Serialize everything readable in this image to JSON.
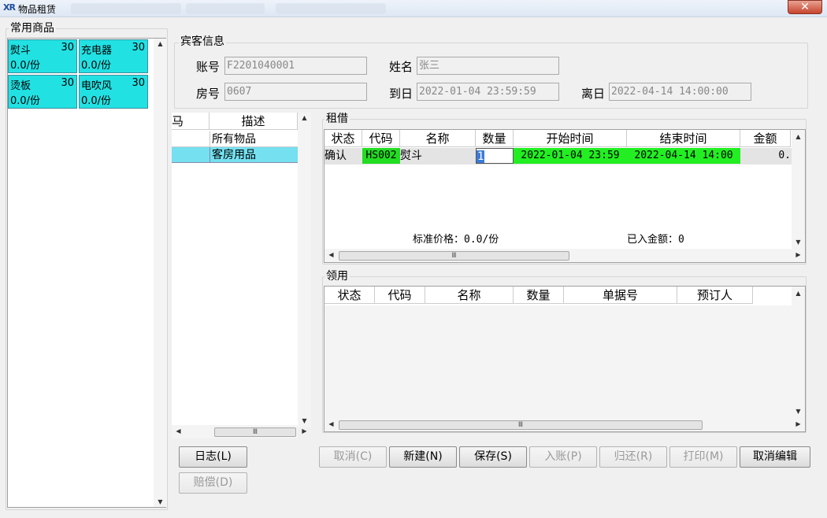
{
  "window": {
    "title": "物品租赁",
    "close_label": "✕",
    "logo": "XR"
  },
  "common_goods": {
    "label": "常用商品",
    "items": [
      {
        "name": "熨斗",
        "qty": "30",
        "price": "0.0/份"
      },
      {
        "name": "充电器",
        "qty": "30",
        "price": "0.0/份"
      },
      {
        "name": "烫板",
        "qty": "30",
        "price": "0.0/份"
      },
      {
        "name": "电吹风",
        "qty": "30",
        "price": "0.0/份"
      }
    ]
  },
  "guest": {
    "label": "宾客信息",
    "account_label": "账号",
    "account_value": "F2201040001",
    "name_label": "姓名",
    "name_value": "张三",
    "room_label": "房号",
    "room_value": "0607",
    "arrive_label": "到日",
    "arrive_value": "2022-01-04 23:59:59",
    "depart_label": "离日",
    "depart_value": "2022-04-14 14:00:00"
  },
  "category": {
    "headers": [
      "马",
      "描述"
    ],
    "rows": [
      {
        "code": "",
        "desc": "所有物品",
        "selected": false
      },
      {
        "code": "",
        "desc": "客房用品",
        "selected": true
      }
    ]
  },
  "rental": {
    "label": "租借",
    "headers": [
      "状态",
      "代码",
      "名称",
      "数量",
      "开始时间",
      "结束时间",
      "金额"
    ],
    "row": {
      "status": "确认",
      "code": "HS002",
      "name": "熨斗",
      "qty": "1",
      "start": "2022-01-04 23:59",
      "end": "2022-04-14 14:00",
      "amount": "0."
    },
    "std_price": "标准价格：0.0/份",
    "posted": "已入金额：0"
  },
  "usage": {
    "label": "领用",
    "headers": [
      "状态",
      "代码",
      "名称",
      "数量",
      "单据号",
      "预订人"
    ]
  },
  "buttons": {
    "log": "日志(L)",
    "compensate": "赔偿(D)",
    "cancel": "取消(C)",
    "new": "新建(N)",
    "save": "保存(S)",
    "post": "入账(P)",
    "return": "归还(R)",
    "print": "打印(M)",
    "cancel_edit": "取消编辑"
  },
  "colors": {
    "tile": "#21e1e3",
    "selected_row": "#74e0f0",
    "time_cell": "#22ee22",
    "code_cell": "#22dd22"
  },
  "scroll_thumb_glyph": "Ⅲ"
}
